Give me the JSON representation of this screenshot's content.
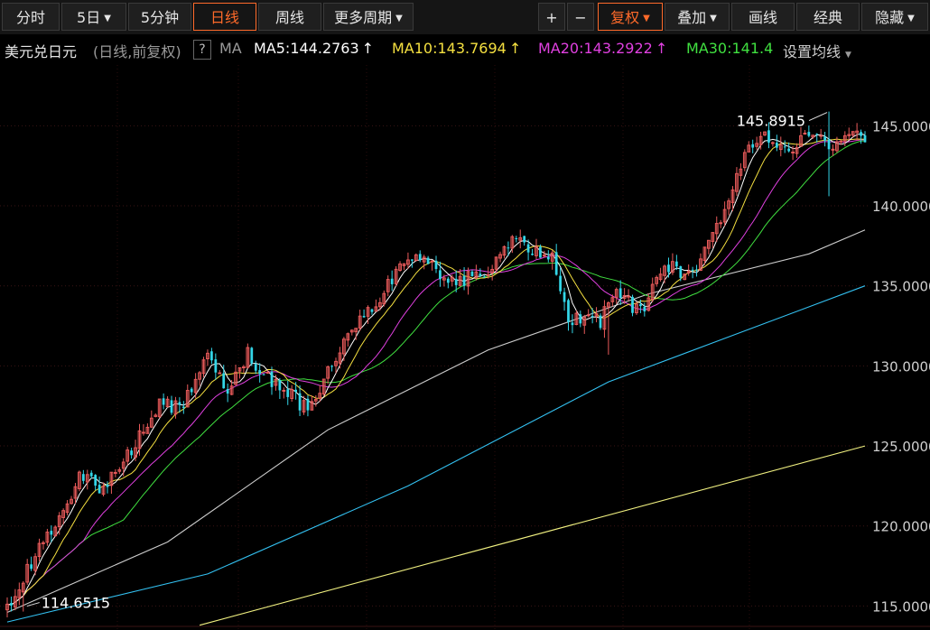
{
  "toolbar": {
    "left": [
      {
        "label": "分时",
        "dropdown": false,
        "active": false
      },
      {
        "label": "5日",
        "dropdown": true,
        "active": false
      },
      {
        "label": "5分钟",
        "dropdown": false,
        "active": false
      },
      {
        "label": "日线",
        "dropdown": false,
        "active": true
      },
      {
        "label": "周线",
        "dropdown": false,
        "active": false
      },
      {
        "label": "更多周期",
        "dropdown": true,
        "active": false
      }
    ],
    "zoom_in": "+",
    "zoom_out": "−",
    "right": [
      {
        "label": "复权",
        "dropdown": true,
        "active": true
      },
      {
        "label": "叠加",
        "dropdown": true,
        "active": false
      },
      {
        "label": "画线",
        "dropdown": false,
        "active": false
      },
      {
        "label": "经典",
        "dropdown": false,
        "active": false
      },
      {
        "label": "隐藏",
        "dropdown": true,
        "active": false
      }
    ],
    "dropdown_glyph": "▼"
  },
  "infobar": {
    "instrument": "美元兑日元",
    "mode": "(日线,前复权)",
    "help": "?",
    "ma_label": "MA",
    "ma5": "MA5:144.2763",
    "ma10": "MA10:143.7694",
    "ma20": "MA20:143.2922",
    "ma30": "MA30:141.4",
    "arrow": "↑",
    "settings": "设置均线",
    "settings_caret": "▼"
  },
  "colors": {
    "up": "#e85a5a",
    "down": "#33d6e8",
    "ma5": "#ffffff",
    "ma10": "#f5e040",
    "ma20": "#e040e0",
    "ma30": "#40e040",
    "ma60": "#cccccc",
    "ma120": "#33c0f0",
    "ma250": "#f0f080",
    "active": "#ff6a2a",
    "axis_text": "#cfcfcf"
  },
  "chart_data": {
    "type": "candlestick",
    "y_axis": {
      "min": 113.5,
      "max": 148.8,
      "ticks": [
        145,
        140,
        135,
        130,
        125,
        120,
        115
      ],
      "tick_labels": [
        "145.0000",
        "140.0000",
        "135.0000",
        "130.0000",
        "125.0000",
        "120.0000",
        "115.0000"
      ]
    },
    "annotations": [
      {
        "text": "145.8915",
        "kind": "high",
        "value": 145.8915
      },
      {
        "text": "114.6515",
        "kind": "low",
        "value": 114.6515
      }
    ],
    "anchors": [
      [
        0,
        115
      ],
      [
        18,
        123
      ],
      [
        24,
        122.3
      ],
      [
        38,
        127.5
      ],
      [
        43,
        127.3
      ],
      [
        50,
        130.8
      ],
      [
        55,
        128.5
      ],
      [
        60,
        130.8
      ],
      [
        65,
        129.3
      ],
      [
        75,
        127.3
      ],
      [
        82,
        130.5
      ],
      [
        98,
        136.2
      ],
      [
        103,
        137
      ],
      [
        110,
        135.3
      ],
      [
        118,
        135.5
      ],
      [
        126,
        138.2
      ],
      [
        132,
        137
      ],
      [
        136,
        137.2
      ],
      [
        140,
        133
      ],
      [
        148,
        132.8
      ],
      [
        152,
        134.8
      ],
      [
        158,
        133.3
      ],
      [
        164,
        136.5
      ],
      [
        170,
        135.5
      ],
      [
        178,
        139
      ],
      [
        184,
        143.5
      ],
      [
        188,
        144.6
      ],
      [
        192,
        143.3
      ],
      [
        196,
        143.5
      ],
      [
        201,
        144.6
      ],
      [
        205,
        143.6
      ],
      [
        210,
        144.6
      ],
      [
        214,
        144.4
      ]
    ],
    "long_ma_lines": [
      {
        "name": "MA60",
        "points": [
          [
            0,
            114.6
          ],
          [
            40,
            119
          ],
          [
            80,
            126
          ],
          [
            120,
            131
          ],
          [
            160,
            134.5
          ],
          [
            200,
            137
          ],
          [
            214,
            138.5
          ]
        ]
      },
      {
        "name": "MA120",
        "points": [
          [
            0,
            114
          ],
          [
            50,
            117
          ],
          [
            100,
            122.5
          ],
          [
            150,
            129
          ],
          [
            214,
            135
          ]
        ]
      },
      {
        "name": "MA250",
        "points": [
          [
            48,
            113.8
          ],
          [
            214,
            125
          ]
        ]
      }
    ]
  }
}
